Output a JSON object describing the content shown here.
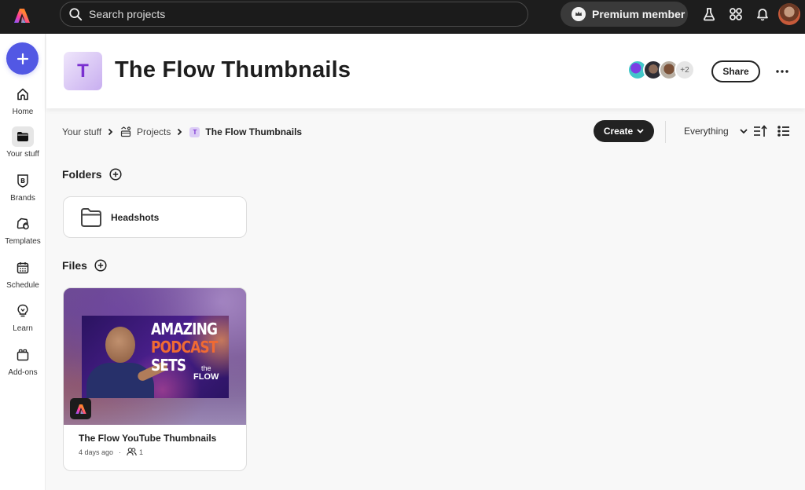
{
  "topbar": {
    "search_placeholder": "Search projects",
    "premium_label": "Premium member",
    "icons": [
      "labs-flask-icon",
      "apps-grid-icon",
      "notifications-bell-icon",
      "user-avatar"
    ]
  },
  "sidebar": {
    "create_label": "+",
    "items": [
      {
        "label": "Home",
        "icon": "home-icon",
        "active": false
      },
      {
        "label": "Your stuff",
        "icon": "folder-icon",
        "active": true
      },
      {
        "label": "Brands",
        "icon": "brand-icon",
        "active": false
      },
      {
        "label": "Templates",
        "icon": "templates-icon",
        "active": false
      },
      {
        "label": "Schedule",
        "icon": "calendar-icon",
        "active": false
      },
      {
        "label": "Learn",
        "icon": "lightbulb-icon",
        "active": false
      },
      {
        "label": "Add-ons",
        "icon": "addons-icon",
        "active": false
      }
    ]
  },
  "header": {
    "project_initial": "T",
    "title": "The Flow Thumbnails",
    "collaborators_extra": "+2",
    "share_label": "Share"
  },
  "breadcrumb": {
    "items": [
      "Your stuff",
      "Projects",
      "The Flow Thumbnails"
    ],
    "current_initial": "T"
  },
  "toolbar": {
    "create_label": "Create",
    "filter_label": "Everything"
  },
  "folders": {
    "title": "Folders",
    "items": [
      {
        "name": "Headshots"
      }
    ]
  },
  "files": {
    "title": "Files",
    "items": [
      {
        "name": "The Flow YouTube Thumbnails",
        "modified": "4 days ago",
        "collaborators": "1",
        "thumbnail": {
          "line1": "AMAZING",
          "line2": "PODCAST",
          "line3": "SETS",
          "brand_small": "the",
          "brand": "FLOW"
        }
      }
    ]
  },
  "colors": {
    "accent": "#5258e4",
    "topbar": "#1d1d1d",
    "project_badge": "#7a2fd0"
  }
}
